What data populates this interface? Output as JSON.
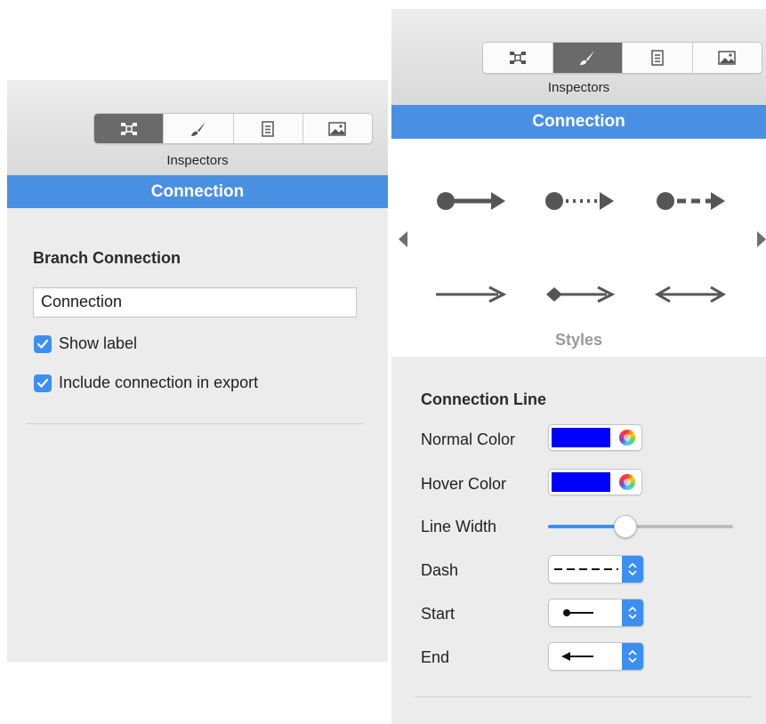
{
  "left_panel": {
    "toolbar": {
      "segments": [
        {
          "icon": "layout-icon",
          "active": true
        },
        {
          "icon": "brush-icon",
          "active": false
        },
        {
          "icon": "document-icon",
          "active": false
        },
        {
          "icon": "image-icon",
          "active": false
        }
      ],
      "label": "Inspectors"
    },
    "header": "Connection",
    "section_title": "Branch Connection",
    "name_field_value": "Connection",
    "checkboxes": [
      {
        "label": "Show label",
        "checked": true
      },
      {
        "label": "Include connection in export",
        "checked": true
      }
    ]
  },
  "right_panel": {
    "toolbar": {
      "segments": [
        {
          "icon": "layout-icon",
          "active": false
        },
        {
          "icon": "brush-icon",
          "active": true
        },
        {
          "icon": "document-icon",
          "active": false
        },
        {
          "icon": "image-icon",
          "active": false
        }
      ],
      "label": "Inspectors"
    },
    "header": "Connection",
    "styles": {
      "label": "Styles",
      "items": [
        {
          "icon": "dot-solid-arrow-icon"
        },
        {
          "icon": "dot-dotted-arrow-icon"
        },
        {
          "icon": "dot-dashed-arrow-icon"
        },
        {
          "icon": "plain-arrow-icon"
        },
        {
          "icon": "diamond-arrow-icon"
        },
        {
          "icon": "double-arrow-icon"
        }
      ]
    },
    "connection_line": {
      "title": "Connection Line",
      "normal_color": {
        "label": "Normal Color",
        "value": "#0000ff"
      },
      "hover_color": {
        "label": "Hover Color",
        "value": "#0000ff"
      },
      "line_width": {
        "label": "Line Width",
        "value_fraction": 0.42
      },
      "dash": {
        "label": "Dash",
        "value_icon": "dashed-line-icon"
      },
      "start": {
        "label": "Start",
        "value_icon": "dot-line-icon"
      },
      "end": {
        "label": "End",
        "value_icon": "left-arrow-line-icon"
      }
    }
  },
  "colors": {
    "accent": "#4a90e2",
    "checkbox": "#3c8ff0",
    "segment_active": "#6a6a6a"
  }
}
